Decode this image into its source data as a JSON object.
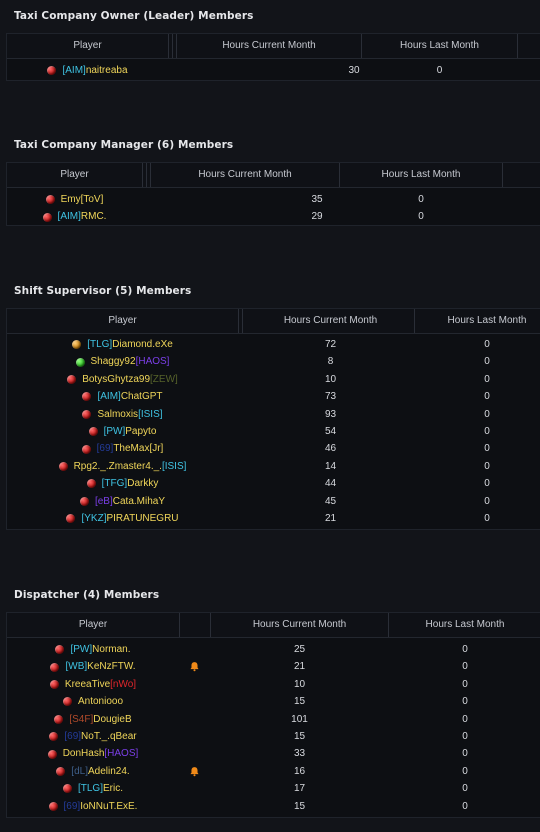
{
  "colors": {
    "background": "#121419",
    "name_yellow": "#f0d65a",
    "tag_cyan": "#3fc3e3",
    "tag_purple": "#7b3fe8",
    "tag_red": "#e0262b",
    "tag_olive": "#56622a",
    "tag_brown": "#b04a2a",
    "tag_darkblue": "#243c9a",
    "tag_slate": "#3e5f8a",
    "bell_orange": "#f08a19"
  },
  "columns": {
    "player": "Player",
    "hours_current": "Hours Current Month",
    "hours_last": "Hours Last Month"
  },
  "sections": [
    {
      "title": "Taxi Company Owner (Leader) Members",
      "members": [
        {
          "status": "red-dot-icon",
          "tag": "[AIM]",
          "tag_color": "#3fc3e3",
          "name": "naitreaba",
          "suffix": "",
          "suffix_color": "",
          "hours_current": "30",
          "hours_last": "0",
          "bell": false
        }
      ]
    },
    {
      "title": "Taxi Company Manager (6) Members",
      "members": [
        {
          "status": "red-dot-icon",
          "tag": "",
          "tag_color": "",
          "name": "Emy",
          "suffix": "[ToV]",
          "suffix_color": "#f0d65a",
          "hours_current": "35",
          "hours_last": "0",
          "bell": false
        },
        {
          "status": "red-dot-icon",
          "tag": "[AIM]",
          "tag_color": "#3fc3e3",
          "name": "RMC.",
          "suffix": "",
          "suffix_color": "",
          "hours_current": "29",
          "hours_last": "0",
          "bell": false
        }
      ]
    },
    {
      "title": "Shift Supervisor (5) Members",
      "members": [
        {
          "status": "orange-dot-icon",
          "tag": "[TLG]",
          "tag_color": "#3fc3e3",
          "name": "Diamond.eXe",
          "suffix": "",
          "suffix_color": "",
          "hours_current": "72",
          "hours_last": "0",
          "bell": false
        },
        {
          "status": "green-dot-icon",
          "tag": "",
          "tag_color": "",
          "name": "Shaggy92",
          "suffix": "[HAOS]",
          "suffix_color": "#7b3fe8",
          "hours_current": "8",
          "hours_last": "0",
          "bell": false
        },
        {
          "status": "red-dot-icon",
          "tag": "",
          "tag_color": "",
          "name": "BotysGhytza99",
          "suffix": "[ZEW]",
          "suffix_color": "#56622a",
          "hours_current": "10",
          "hours_last": "0",
          "bell": false
        },
        {
          "status": "red-dot-icon",
          "tag": "[AIM]",
          "tag_color": "#3fc3e3",
          "name": "ChatGPT",
          "suffix": "",
          "suffix_color": "",
          "hours_current": "73",
          "hours_last": "0",
          "bell": false
        },
        {
          "status": "red-dot-icon",
          "tag": "",
          "tag_color": "",
          "name": "Salmoxis",
          "suffix": "[ISIS]",
          "suffix_color": "#3fc3e3",
          "hours_current": "93",
          "hours_last": "0",
          "bell": false
        },
        {
          "status": "red-dot-icon",
          "tag": "[PW]",
          "tag_color": "#3fc3e3",
          "name": "Papyto",
          "suffix": "",
          "suffix_color": "",
          "hours_current": "54",
          "hours_last": "0",
          "bell": false
        },
        {
          "status": "red-dot-icon",
          "tag": "[69]",
          "tag_color": "#243c9a",
          "name": "TheMax",
          "suffix": "[Jr]",
          "suffix_color": "#f0d65a",
          "hours_current": "46",
          "hours_last": "0",
          "bell": false
        },
        {
          "status": "red-dot-icon",
          "tag": "",
          "tag_color": "",
          "name": "Rpg2._.Zmaster4._.",
          "suffix": "[ISIS]",
          "suffix_color": "#3fc3e3",
          "hours_current": "14",
          "hours_last": "0",
          "bell": false
        },
        {
          "status": "red-dot-icon",
          "tag": "[TFG]",
          "tag_color": "#3fc3e3",
          "name": "Darkky",
          "suffix": "",
          "suffix_color": "",
          "hours_current": "44",
          "hours_last": "0",
          "bell": false
        },
        {
          "status": "red-dot-icon",
          "tag": "[eB]",
          "tag_color": "#7b3fe8",
          "name": "Cata.MihaY",
          "suffix": "",
          "suffix_color": "",
          "hours_current": "45",
          "hours_last": "0",
          "bell": false
        },
        {
          "status": "red-dot-icon",
          "tag": "[YKZ]",
          "tag_color": "#3fc3e3",
          "name": "PIRATUNEGRU",
          "suffix": "",
          "suffix_color": "",
          "hours_current": "21",
          "hours_last": "0",
          "bell": false
        }
      ]
    },
    {
      "title": "Dispatcher (4) Members",
      "members": [
        {
          "status": "red-dot-icon",
          "tag": "[PW]",
          "tag_color": "#3fc3e3",
          "name": "Norman.",
          "suffix": "",
          "suffix_color": "",
          "hours_current": "25",
          "hours_last": "0",
          "bell": false
        },
        {
          "status": "red-dot-icon",
          "tag": "[WB]",
          "tag_color": "#3fc3e3",
          "name": "KeNzFTW.",
          "suffix": "",
          "suffix_color": "",
          "hours_current": "21",
          "hours_last": "0",
          "bell": true
        },
        {
          "status": "red-dot-icon",
          "tag": "",
          "tag_color": "",
          "name": "KreeaTive",
          "suffix": "[nWo]",
          "suffix_color": "#e0262b",
          "hours_current": "10",
          "hours_last": "0",
          "bell": false
        },
        {
          "status": "red-dot-icon",
          "tag": "",
          "tag_color": "",
          "name": "Antoniooo",
          "suffix": "",
          "suffix_color": "",
          "hours_current": "15",
          "hours_last": "0",
          "bell": false
        },
        {
          "status": "red-dot-icon",
          "tag": "[S4F]",
          "tag_color": "#b04a2a",
          "name": "DougieB",
          "suffix": "",
          "suffix_color": "",
          "hours_current": "101",
          "hours_last": "0",
          "bell": false
        },
        {
          "status": "red-dot-icon",
          "tag": "[69]",
          "tag_color": "#243c9a",
          "name": "NoT._.qBear",
          "suffix": "",
          "suffix_color": "",
          "hours_current": "15",
          "hours_last": "0",
          "bell": false
        },
        {
          "status": "red-dot-icon",
          "tag": "",
          "tag_color": "",
          "name": "DonHash",
          "suffix": "[HAOS]",
          "suffix_color": "#7b3fe8",
          "hours_current": "33",
          "hours_last": "0",
          "bell": false
        },
        {
          "status": "red-dot-icon",
          "tag": "[dL]",
          "tag_color": "#3e5f8a",
          "name": "Adelin24.",
          "suffix": "",
          "suffix_color": "",
          "hours_current": "16",
          "hours_last": "0",
          "bell": true
        },
        {
          "status": "red-dot-icon",
          "tag": "[TLG]",
          "tag_color": "#3fc3e3",
          "name": "Eric.",
          "suffix": "",
          "suffix_color": "",
          "hours_current": "17",
          "hours_last": "0",
          "bell": false
        },
        {
          "status": "red-dot-icon",
          "tag": "[69]",
          "tag_color": "#243c9a",
          "name": "IoNNuT.ExE.",
          "suffix": "",
          "suffix_color": "",
          "hours_current": "15",
          "hours_last": "0",
          "bell": false
        }
      ]
    }
  ]
}
